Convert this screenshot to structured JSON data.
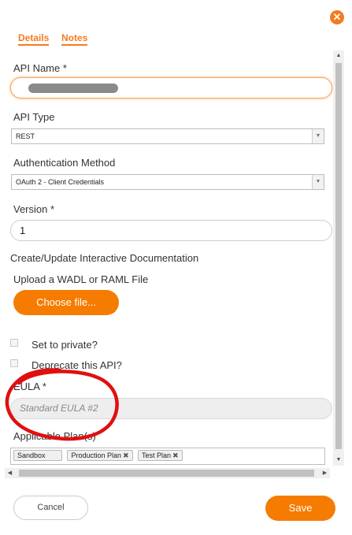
{
  "dialog": {
    "close_icon": "close-icon",
    "tabs": [
      {
        "label": "Details"
      },
      {
        "label": "Notes"
      }
    ]
  },
  "form": {
    "api_name": {
      "label": "API Name *",
      "value": ""
    },
    "api_type": {
      "label": "API Type",
      "value": "REST"
    },
    "auth_method": {
      "label": "Authentication Method",
      "value": "OAuth 2 - Client Credentials"
    },
    "version": {
      "label": "Version *",
      "value": "1"
    },
    "interactive_docs": {
      "label": "Create/Update Interactive Documentation"
    },
    "upload": {
      "label": "Upload a WADL or RAML File",
      "button": "Choose file..."
    },
    "private": {
      "label": "Set to private?",
      "checked": false
    },
    "deprecate": {
      "label": "Deprecate this API?",
      "checked": false
    },
    "eula": {
      "label": "EULA *",
      "value": "Standard EULA #2"
    },
    "plans": {
      "label": "Applicable Plan(s)",
      "chips": [
        {
          "label": "Sandbox",
          "removable": false
        },
        {
          "label": "Production Plan",
          "removable": true
        },
        {
          "label": "Test Plan",
          "removable": true
        }
      ]
    }
  },
  "footer": {
    "cancel": "Cancel",
    "save": "Save"
  },
  "colors": {
    "accent": "#f57c00",
    "annotation": "#e01010"
  }
}
